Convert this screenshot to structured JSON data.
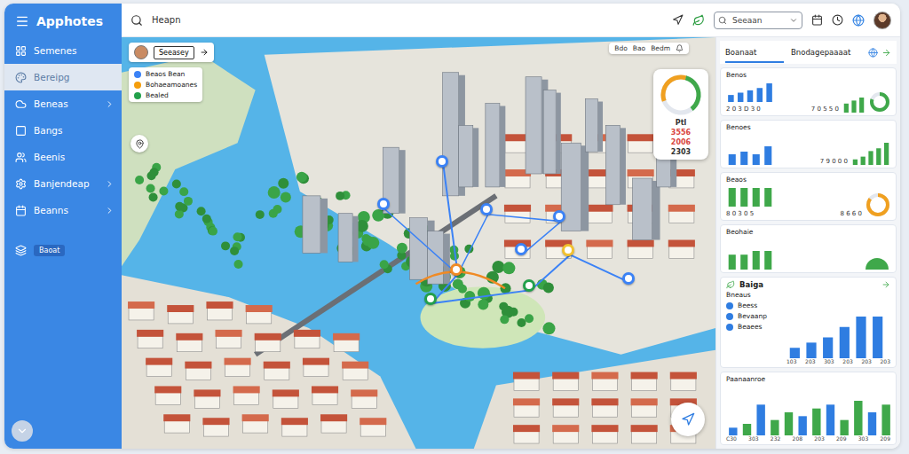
{
  "app": {
    "title": "Apphotes"
  },
  "sidebar": {
    "items": [
      {
        "label": "Semenes",
        "selected": false,
        "expandable": false
      },
      {
        "label": "Bereipg",
        "selected": true,
        "expandable": false
      },
      {
        "label": "Beneas",
        "selected": false,
        "expandable": true
      },
      {
        "label": "Bangs",
        "selected": false,
        "expandable": false
      },
      {
        "label": "Beenis",
        "selected": false,
        "expandable": false
      },
      {
        "label": "Banjendeap",
        "selected": false,
        "expandable": true
      },
      {
        "label": "Beanns",
        "selected": false,
        "expandable": true
      }
    ],
    "badge": "Baoat"
  },
  "topbar": {
    "query": "Heapn",
    "search_placeholder": "Seeaan"
  },
  "map": {
    "user_chip": "Seeasey",
    "legend": [
      {
        "label": "Beaos Bean",
        "color": "#3b82f6"
      },
      {
        "label": "Bohaeamoanes",
        "color": "#f59e0b"
      },
      {
        "label": "Bealed",
        "color": "#22a04a"
      }
    ],
    "toolbar": [
      "Bdo",
      "Bao",
      "Bedm"
    ],
    "gauge": {
      "level": 0.7,
      "label": "Ptl",
      "readings": [
        {
          "text": "3556",
          "color": "#d9473f"
        },
        {
          "text": "2006",
          "color": "#d9473f"
        },
        {
          "text": "2303",
          "color": "#333333"
        }
      ]
    },
    "pins": [
      {
        "color": "#3b82f6"
      },
      {
        "color": "#3b82f6"
      },
      {
        "color": "#3b82f6"
      },
      {
        "color": "#3b82f6"
      },
      {
        "color": "#3b82f6"
      },
      {
        "color": "#f08a24"
      },
      {
        "color": "#22a04a"
      },
      {
        "color": "#22a04a"
      },
      {
        "color": "#f2c12e"
      },
      {
        "color": "#3b82f6"
      }
    ]
  },
  "panel": {
    "tabs": [
      {
        "label": "Boanaat",
        "selected": true
      },
      {
        "label": "Bnodagepaaaat",
        "selected": false
      }
    ],
    "cards": [
      {
        "title": "Benos",
        "left": {
          "values": [
            3,
            4,
            5,
            6,
            8
          ],
          "color": "#2f7de1",
          "caption": "2 0 3 D 3 0"
        },
        "right": {
          "kind": "bars-donut",
          "caption": "7 0 5 5 0",
          "values": [
            3,
            4,
            5
          ],
          "color": "#3fa84a",
          "level": 0.8
        }
      },
      {
        "title": "Benoes",
        "left": {
          "values": [
            4,
            5,
            4,
            7
          ],
          "color": "#2f7de1"
        },
        "right": {
          "kind": "bars",
          "caption": "7 9 0 0 0",
          "values": [
            2,
            3,
            5,
            6,
            8
          ],
          "color": "#3fa84a"
        }
      },
      {
        "title": "Beaos",
        "left": {
          "values": [
            5,
            5,
            5,
            5
          ],
          "color": "#3fa84a",
          "caption": "8 0 3 0 5"
        },
        "right": {
          "kind": "donut",
          "caption": "8 6 6 0",
          "color": "#f0a020",
          "level": 0.85
        }
      },
      {
        "title": "Beohaie",
        "left": {
          "values": [
            4,
            4,
            5,
            5
          ],
          "color": "#3fa84a"
        },
        "right": {
          "kind": "half",
          "color": "#3fa84a"
        }
      }
    ],
    "section": {
      "title": "Baiga",
      "heading": "Bneaus",
      "legend": [
        {
          "label": "Beess",
          "color": "#2f7de1"
        },
        {
          "label": "Bevaanp",
          "color": "#2f7de1"
        },
        {
          "label": "Beaees",
          "color": "#2f7de1"
        }
      ],
      "values": [
        2,
        3,
        4,
        6,
        8,
        8
      ],
      "ticks": [
        "103",
        "203",
        "303",
        "203",
        "203",
        "203"
      ]
    },
    "bottom_chart": {
      "title": "Paanaanroe",
      "bars": [
        {
          "value": 2,
          "color": "#2f7de1"
        },
        {
          "value": 3,
          "color": "#3fa84a"
        },
        {
          "value": 8,
          "color": "#2f7de1"
        },
        {
          "value": 4,
          "color": "#3fa84a"
        },
        {
          "value": 6,
          "color": "#3fa84a"
        },
        {
          "value": 5,
          "color": "#2f7de1"
        },
        {
          "value": 7,
          "color": "#3fa84a"
        },
        {
          "value": 8,
          "color": "#2f7de1"
        },
        {
          "value": 4,
          "color": "#3fa84a"
        },
        {
          "value": 9,
          "color": "#3fa84a"
        },
        {
          "value": 6,
          "color": "#2f7de1"
        },
        {
          "value": 8,
          "color": "#3fa84a"
        }
      ],
      "ticks": [
        "C30",
        "303",
        "232",
        "208",
        "203",
        "209",
        "303",
        "209"
      ]
    }
  }
}
